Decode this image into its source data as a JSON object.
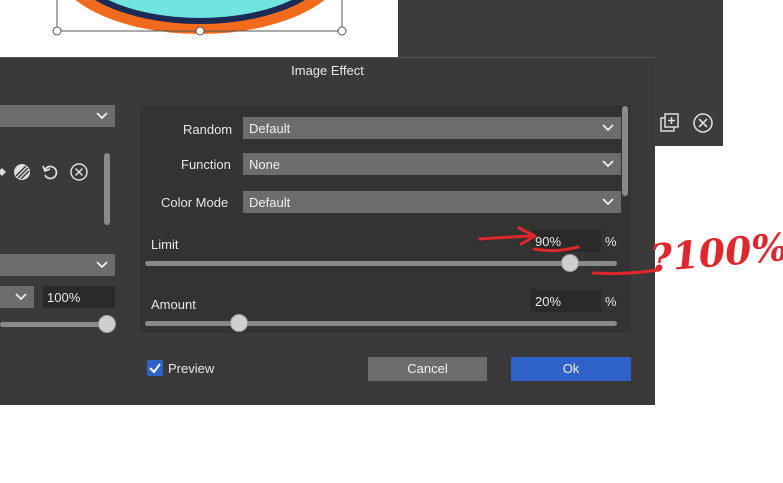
{
  "dialog": {
    "title": "Image Effect",
    "left_pane": {
      "zoom_value": "100%"
    },
    "fields": {
      "random": {
        "label": "Random",
        "value": "Default"
      },
      "function": {
        "label": "Function",
        "value": "None"
      },
      "color_mode": {
        "label": "Color Mode",
        "value": "Default"
      }
    },
    "limit": {
      "label": "Limit",
      "value": "90%",
      "unit": "%",
      "slider_level_percent": 90
    },
    "amount": {
      "label": "Amount",
      "value": "20%",
      "unit": "%",
      "slider_level_percent": 20
    },
    "preview": {
      "label": "Preview",
      "checked": true
    },
    "buttons": {
      "cancel": "Cancel",
      "ok": "Ok"
    }
  },
  "annotation": {
    "text": "?100%"
  },
  "icons": [
    "chevron-down-icon",
    "check-icon",
    "undo-icon",
    "close-circle-icon",
    "add-layer-icon",
    "pattern-icon"
  ],
  "colors": {
    "accent": "#2f62c9",
    "annotation": "#e0272d",
    "dialog_bg": "#3a3a3a",
    "panel_bg": "#333333",
    "select_bg": "#6c6c6c"
  }
}
